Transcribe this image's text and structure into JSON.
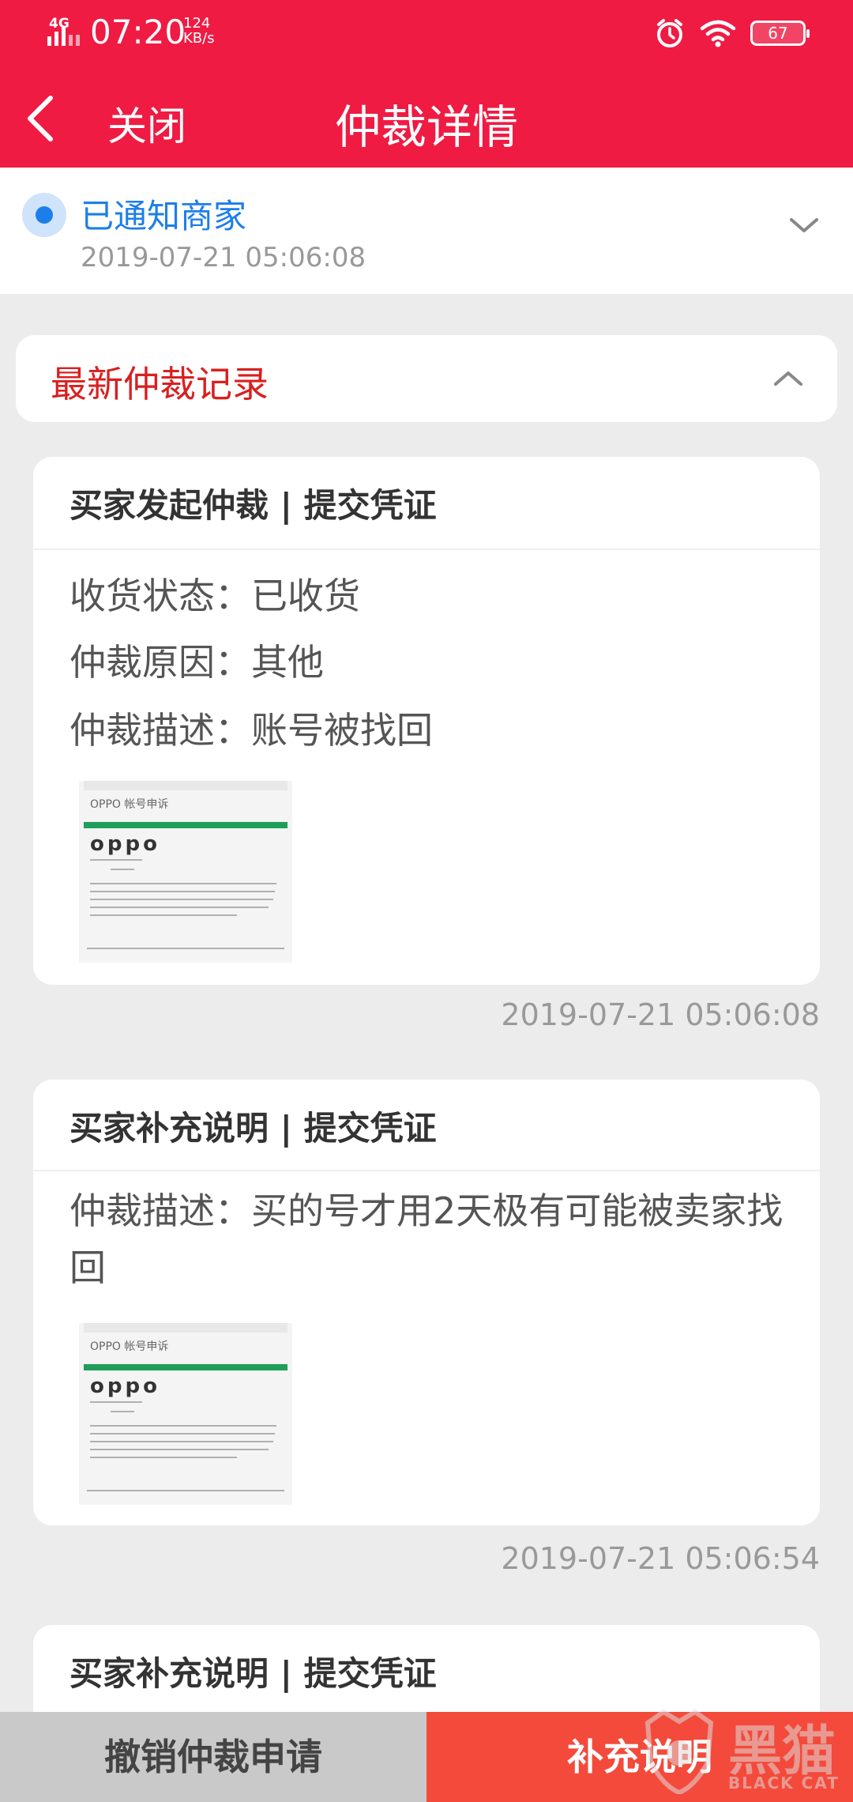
{
  "status_bar": {
    "network": "4G",
    "time": "07:20",
    "speed_value": "124",
    "speed_unit": "KB/s",
    "battery": "67"
  },
  "nav": {
    "close_label": "关闭",
    "title": "仲裁详情"
  },
  "status": {
    "label": "已通知商家",
    "time": "2019-07-21 05:06:08"
  },
  "records": {
    "header": "最新仲裁记录",
    "items": [
      {
        "title": "买家发起仲裁 | 提交凭证",
        "lines": [
          "收货状态：已收货",
          "仲裁原因：其他",
          "仲裁描述：账号被找回"
        ],
        "time": "2019-07-21 05:06:08"
      },
      {
        "title": "买家补充说明 | 提交凭证",
        "description": "仲裁描述：买的号才用2天极有可能被卖家找回",
        "time": "2019-07-21 05:06:54"
      },
      {
        "title": "买家补充说明 | 提交凭证"
      }
    ]
  },
  "thumbnail": {
    "brand_text": "oppo",
    "header_text": "OPPO 帐号申诉"
  },
  "actions": {
    "cancel_label": "撤销仲裁申请",
    "supplement_label": "补充说明"
  },
  "watermark": {
    "text": "黑猫",
    "sub": "BLACK CAT"
  },
  "colors": {
    "brand_red": "#ef1b43",
    "status_blue": "#1c7eea",
    "record_red": "#d9201f",
    "action_red": "#f34a3b"
  }
}
